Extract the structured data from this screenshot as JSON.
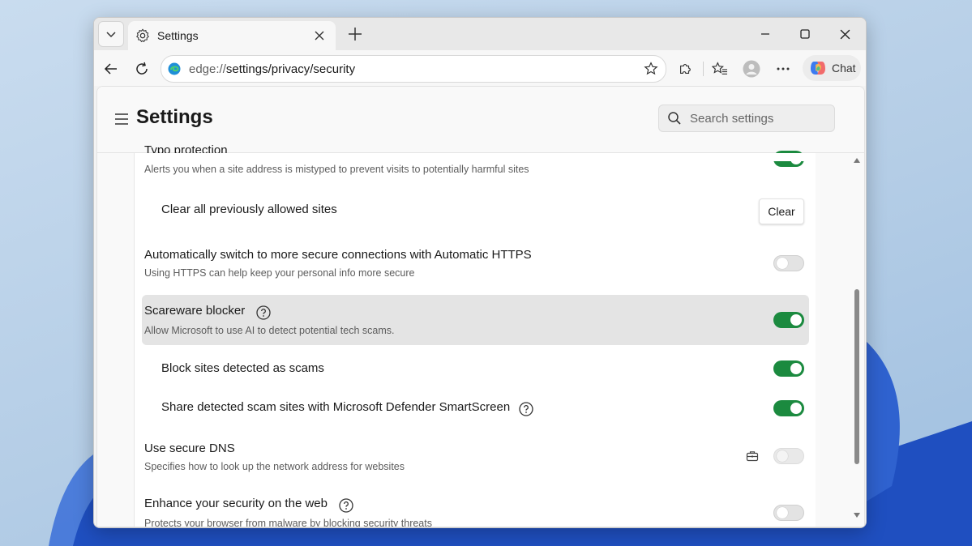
{
  "browser": {
    "tab_title": "Settings",
    "url_prefix": "edge://",
    "url_path": "settings/privacy/security",
    "chat_label": "Chat"
  },
  "settings": {
    "title": "Settings",
    "search_placeholder": "Search settings",
    "items": [
      {
        "title": "Typo protection",
        "subtitle": "Alerts you when a site address is mistyped to prevent visits to potentially harmful sites",
        "toggle": "on"
      },
      {
        "title": "Clear all previously allowed sites",
        "button": "Clear"
      },
      {
        "title": "Automatically switch to more secure connections with Automatic HTTPS",
        "subtitle": "Using HTTPS can help keep your personal info more secure",
        "toggle": "off"
      },
      {
        "title": "Scareware blocker",
        "subtitle": "Allow Microsoft to use AI to detect potential tech scams.",
        "toggle": "on"
      },
      {
        "title": "Block sites detected as scams",
        "toggle": "on"
      },
      {
        "title": "Share detected scam sites with Microsoft Defender SmartScreen",
        "toggle": "on"
      },
      {
        "title": "Use secure DNS",
        "subtitle": "Specifies how to look up the network address for websites",
        "toggle": "disabled"
      },
      {
        "title": "Enhance your security on the web",
        "subtitle": "Protects your browser from malware by blocking security threats",
        "toggle": "off"
      }
    ]
  },
  "colors": {
    "toggle_on": "#1b8a3f",
    "highlight_row": "#e4e4e4"
  }
}
